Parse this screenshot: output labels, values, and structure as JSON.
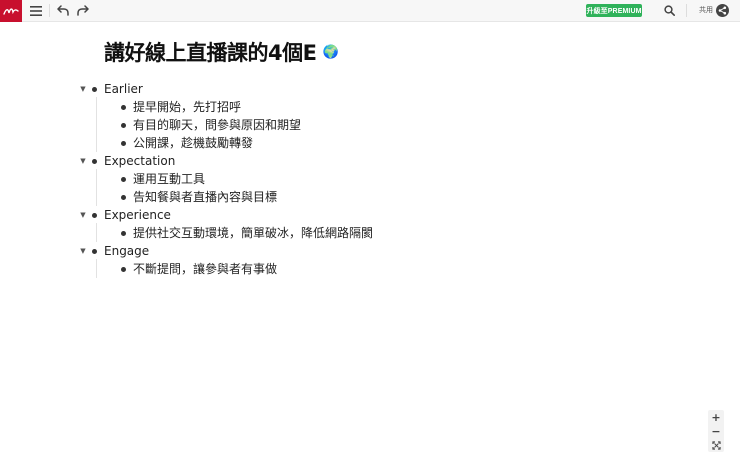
{
  "toolbar": {
    "premium_label": "升級至PREMIUM",
    "share_label": "共用",
    "icons": {
      "logo": "mindnode-logo",
      "menu": "hamburger-menu-icon",
      "undo": "undo-icon",
      "redo": "redo-icon",
      "search": "search-icon",
      "share": "share-icon"
    },
    "colors": {
      "logo_bg": "#c8102e",
      "premium_bg": "#2fb25a"
    }
  },
  "document": {
    "title": "講好線上直播課的4個E",
    "title_icon": "globe-icon",
    "nodes": [
      {
        "label": "Earlier",
        "children": [
          {
            "label": "提早開始，先打招呼"
          },
          {
            "label": "有目的聊天，問參與原因和期望"
          },
          {
            "label": "公開課，趁機鼓勵轉發"
          }
        ]
      },
      {
        "label": "Expectation",
        "children": [
          {
            "label": "運用互動工具"
          },
          {
            "label": "告知餐與者直播內容與目標"
          }
        ]
      },
      {
        "label": "Experience",
        "children": [
          {
            "label": "提供社交互動環境，簡單破冰，降低網路隔閡"
          }
        ]
      },
      {
        "label": "Engage",
        "children": [
          {
            "label": "不斷提問，讓參與者有事做"
          }
        ]
      }
    ]
  },
  "zoom": {
    "zoom_in": "+",
    "zoom_out": "−",
    "fit": "fit-screen-icon"
  }
}
